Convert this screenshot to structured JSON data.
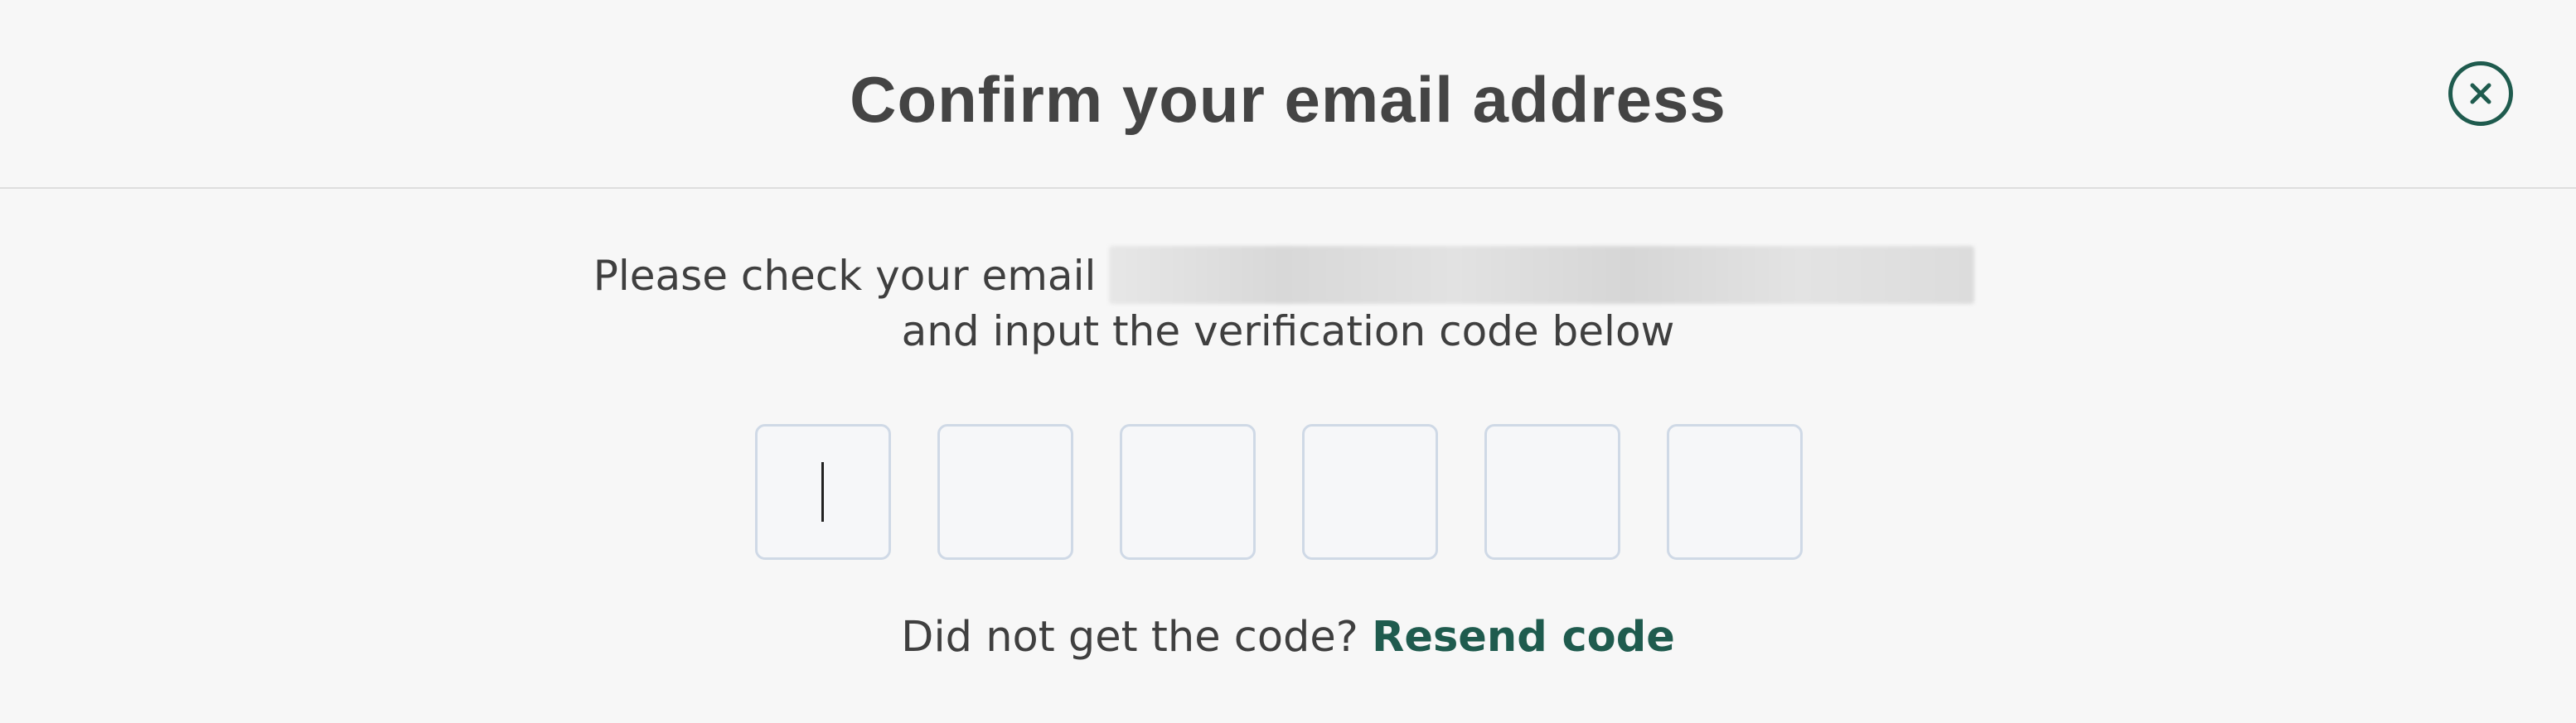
{
  "dialog": {
    "title": "Confirm your email address",
    "close_icon": "close-circle-icon",
    "instructions_line1": "Please check your email",
    "email_value": "",
    "instructions_line2": "and input the verification code below",
    "code_inputs": [
      "",
      "",
      "",
      "",
      "",
      ""
    ],
    "resend_prompt": "Did not get the code?",
    "resend_link": "Resend code"
  },
  "colors": {
    "accent": "#1f5b4e",
    "background": "#f7f7f7",
    "text": "#3d3d3d",
    "input_border": "#cfd9e6"
  }
}
